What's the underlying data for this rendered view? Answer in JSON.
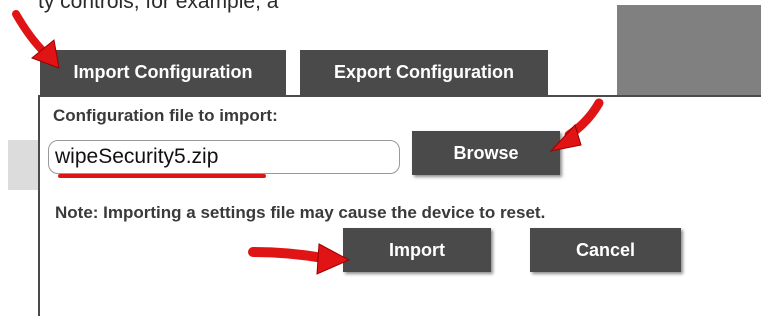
{
  "top_snippet": "ty controls, for example, a",
  "tabs": [
    {
      "label": "Import Configuration",
      "active": true
    },
    {
      "label": "Export Configuration",
      "active": false
    }
  ],
  "import_panel": {
    "file_label": "Configuration file to import:",
    "file_value": "wipeSecurity5.zip",
    "browse_label": "Browse",
    "note": "Note: Importing a settings file may cause the device to reset.",
    "import_label": "Import",
    "cancel_label": "Cancel"
  },
  "annotations": {
    "arrow_color": "#e01414",
    "underline_color": "#e01414"
  }
}
